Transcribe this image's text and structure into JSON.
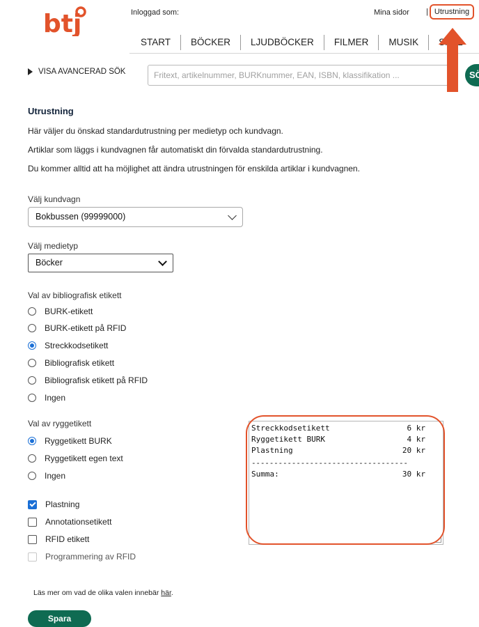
{
  "header": {
    "logo_text": "btj",
    "logged_in_label": "Inloggad som:",
    "mina_sidor": "Mina sidor",
    "separator": "|",
    "utrustning": "Utrustning",
    "nav": [
      "START",
      "BÖCKER",
      "LJUDBÖCKER",
      "FILMER",
      "MUSIK",
      "SPEL"
    ],
    "advanced_search": "VISA AVANCERAD SÖK",
    "search_placeholder": "Fritext, artikelnummer, BURKnummer, EAN, ISBN, klassifikation ...",
    "search_button": "SÖK",
    "accent_color": "#0f6b52",
    "highlight_color": "#e2532b"
  },
  "main": {
    "title": "Utrustning",
    "intro": [
      "Här väljer du önskad standardutrustning per medietyp och kundvagn.",
      "Artiklar som läggs i kundvagnen får automatiskt din förvalda standardutrustning.",
      "Du kommer alltid att ha möjlighet att ändra utrustningen för enskilda artiklar i kundvagnen."
    ],
    "cart_label": "Välj kundvagn",
    "cart_value": "Bokbussen (99999000)",
    "media_label": "Välj medietyp",
    "media_value": "Böcker",
    "biblio_label": "Val av bibliografisk etikett",
    "biblio_options": [
      {
        "label": "BURK-etikett",
        "checked": false
      },
      {
        "label": "BURK-etikett på RFID",
        "checked": false
      },
      {
        "label": "Streckkodsetikett",
        "checked": true
      },
      {
        "label": "Bibliografisk etikett",
        "checked": false
      },
      {
        "label": "Bibliografisk etikett på RFID",
        "checked": false
      },
      {
        "label": "Ingen",
        "checked": false
      }
    ],
    "spine_label": "Val av ryggetikett",
    "spine_options": [
      {
        "label": "Ryggetikett BURK",
        "checked": true
      },
      {
        "label": "Ryggetikett egen text",
        "checked": false
      },
      {
        "label": "Ingen",
        "checked": false
      }
    ],
    "extras": [
      {
        "label": "Plastning",
        "checked": true,
        "disabled": false
      },
      {
        "label": "Annotationsetikett",
        "checked": false,
        "disabled": false
      },
      {
        "label": "RFID etikett",
        "checked": false,
        "disabled": false
      },
      {
        "label": "Programmering av RFID",
        "checked": false,
        "disabled": true
      }
    ],
    "summary": {
      "rows": [
        {
          "name": "Streckkodsetikett",
          "price": "6 kr"
        },
        {
          "name": "Ryggetikett BURK",
          "price": "4 kr"
        },
        {
          "name": "Plastning",
          "price": "20 kr"
        }
      ],
      "divider": "-----------------------------------",
      "total_label": "Summa:",
      "total_value": "30 kr"
    },
    "read_more_text": "Läs mer om vad de olika valen innebär ",
    "read_more_link": "här",
    "read_more_end": ".",
    "save_button": "Spara"
  }
}
